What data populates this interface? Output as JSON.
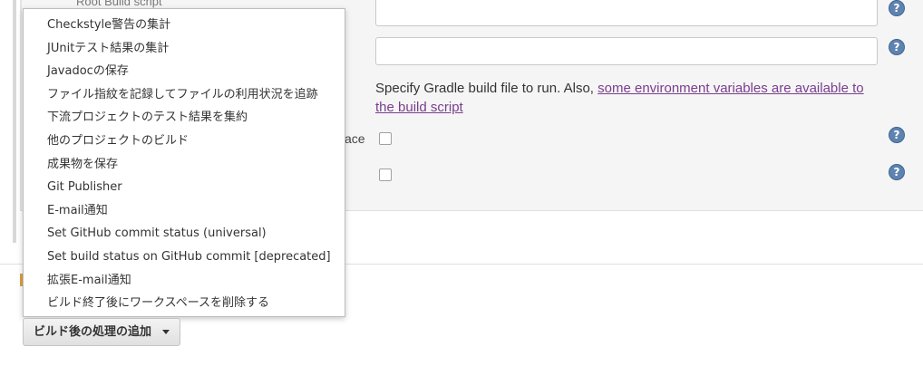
{
  "config": {
    "hidden_label": "Root Build script",
    "gradle_description": "Specify Gradle build file to run. Also, ",
    "gradle_link": "some environment variables are available to the build script",
    "partial_label": "ace"
  },
  "menu": {
    "items": [
      "Checkstyle警告の集計",
      "JUnitテスト結果の集計",
      "Javadocの保存",
      "ファイル指紋を記録してファイルの利用状況を追跡",
      "下流プロジェクトのテスト結果を集約",
      "他のプロジェクトのビルド",
      "成果物を保存",
      "Git Publisher",
      "E-mail通知",
      "Set GitHub commit status (universal)",
      "Set build status on GitHub commit [deprecated]",
      "拡張E-mail通知",
      "ビルド終了後にワークスペースを削除する"
    ]
  },
  "toolbar": {
    "add_post_build_label": "ビルド後の処理の追加"
  },
  "icons": {
    "help": "help-icon",
    "caret": "caret-down-icon"
  },
  "colors": {
    "link": "#7a3e8e",
    "help_icon": "#5f83b0"
  }
}
